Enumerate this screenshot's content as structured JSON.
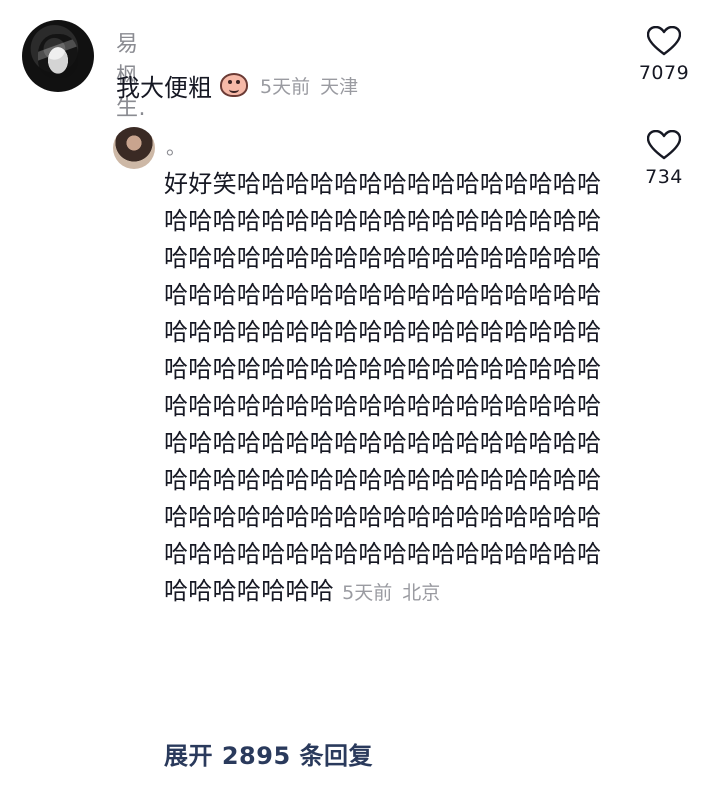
{
  "comment": {
    "username": "易枫生.",
    "text": "我大便粗",
    "emoji": "pig-face-emoji",
    "time": "5天前",
    "location": "天津",
    "likes": "7079"
  },
  "reply": {
    "username": "。",
    "text": "好好笑哈哈哈哈哈哈哈哈哈哈哈哈哈哈哈哈哈哈哈哈哈哈哈哈哈哈哈哈哈哈哈哈哈哈哈哈哈哈哈哈哈哈哈哈哈哈哈哈哈哈哈哈哈哈哈哈哈哈哈哈哈哈哈哈哈哈哈哈哈哈哈哈哈哈哈哈哈哈哈哈哈哈哈哈哈哈哈哈哈哈哈哈哈哈哈哈哈哈哈哈哈哈哈哈哈哈哈哈哈哈哈哈哈哈哈哈哈哈哈哈哈哈哈哈哈哈哈哈哈哈哈哈哈哈哈哈哈哈哈哈哈哈哈哈哈哈哈哈哈哈哈哈哈哈哈哈哈哈哈哈哈哈哈哈哈哈哈哈哈哈哈哈哈哈哈哈哈哈哈哈哈哈哈哈哈哈哈哈哈哈哈哈哈哈哈哈哈哈哈哈哈哈",
    "time": "5天前",
    "location": "北京",
    "likes": "734"
  },
  "expand_label": "展开 2895 条回复",
  "colors": {
    "text": "#161823",
    "meta": "#9a9ba1",
    "expand": "#2a3a5c"
  }
}
